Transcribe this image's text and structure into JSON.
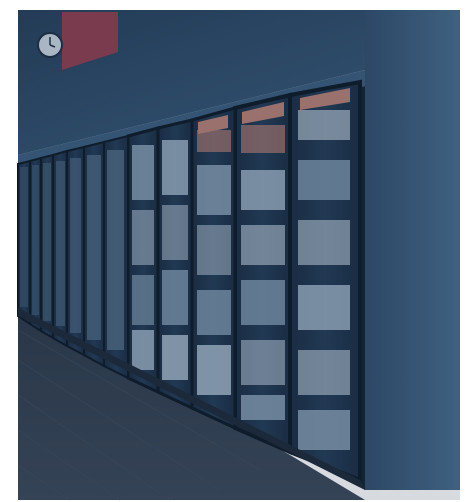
{
  "photo": {
    "subject": "",
    "palette": {
      "frame": "#ffffff",
      "overlay": "#223a55",
      "ceiling": "#2f4e6c",
      "wall": "#3b5d7d",
      "wall_dark": "#314f6d",
      "floor": "#2f3b4b",
      "floor_grain": "#3a4658",
      "door_frame": "#0f1c2b",
      "glass": "#1b2e44",
      "product_light": "#c8d6e3",
      "product_mid": "#7d96ad",
      "product_accent": "#b57e73",
      "sign": "#8f3c4e"
    }
  }
}
